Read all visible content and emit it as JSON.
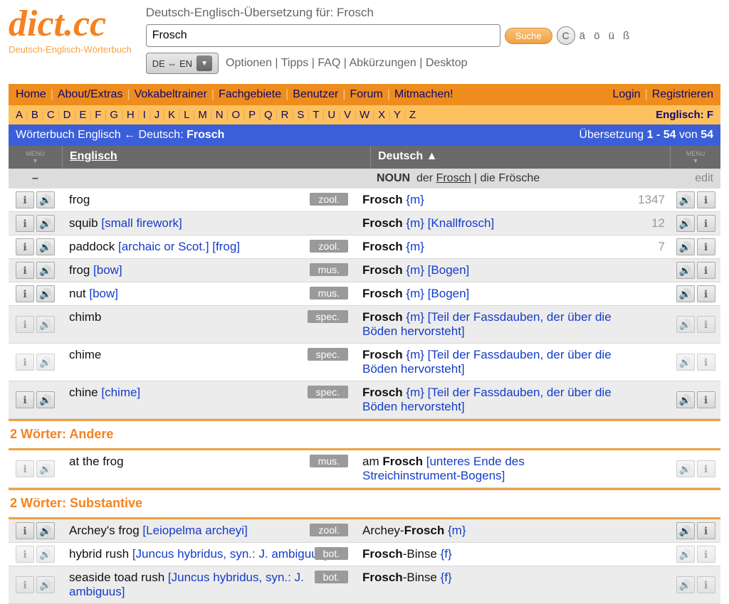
{
  "logo": "dict.cc",
  "logo_sub": "Deutsch-Englisch-Wörterbuch",
  "search_title": "Deutsch-Englisch-Übersetzung für: Frosch",
  "search_value": "Frosch",
  "btn_search": "Suche",
  "btn_c": "C",
  "umlauts": "ä ö ü ß",
  "lang_sel": "DE ⇔ EN",
  "opts": [
    "Optionen",
    "Tipps",
    "FAQ",
    "Abkürzungen",
    "Desktop"
  ],
  "nav": [
    "Home",
    "About/Extras",
    "Vokabeltrainer",
    "Fachgebiete",
    "Benutzer",
    "Forum",
    "Mitmachen!"
  ],
  "nav_right": [
    "Login",
    "Registrieren"
  ],
  "alpha": [
    "A",
    "B",
    "C",
    "D",
    "E",
    "F",
    "G",
    "H",
    "I",
    "J",
    "K",
    "L",
    "M",
    "N",
    "O",
    "P",
    "Q",
    "R",
    "S",
    "T",
    "U",
    "V",
    "W",
    "X",
    "Y",
    "Z"
  ],
  "alpha_right": "Englisch: F",
  "blue_left_a": "Wörterbuch Englisch ← Deutsch: ",
  "blue_left_b": "Frosch",
  "blue_right_a": "Übersetzung ",
  "blue_right_b": "1 - 54",
  "blue_right_c": " von ",
  "blue_right_d": "54",
  "col_en": "Englisch",
  "col_de": "Deutsch",
  "col_de_sort": "▲",
  "menu_label": "MENU",
  "noun_dash": "–",
  "noun_label": "NOUN",
  "noun_text_a": "der ",
  "noun_text_b": "Frosch",
  "noun_text_c": " | die Frösche",
  "edit": "edit",
  "rows": [
    {
      "en": "frog",
      "en_ext": "",
      "tag": "zool.",
      "de": "Frosch",
      "g": "{m}",
      "de_ext": "",
      "cnt": "1347",
      "bold": true,
      "g2": false
    },
    {
      "en": "squib",
      "en_ext": " [small firework]",
      "tag": "",
      "de": "Frosch",
      "g": "{m}",
      "de_ext": " [Knallfrosch]",
      "cnt": "12",
      "bold": true,
      "g2": true
    },
    {
      "en": "paddock",
      "en_ext": " [archaic or Scot.] [frog]",
      "tag": "zool.",
      "de": "Frosch",
      "g": "{m}",
      "de_ext": "",
      "cnt": "7",
      "bold": true,
      "g2": false
    },
    {
      "en": "frog",
      "en_ext": " [bow]",
      "tag": "mus.",
      "de": "Frosch",
      "g": "{m}",
      "de_ext": " [Bogen]",
      "cnt": "",
      "bold": true,
      "g2": true
    },
    {
      "en": "nut",
      "en_ext": " [bow]",
      "tag": "mus.",
      "de": "Frosch",
      "g": "{m}",
      "de_ext": " [Bogen]",
      "cnt": "",
      "bold": true,
      "g2": false
    },
    {
      "en": "chimb",
      "en_ext": "",
      "tag": "spec.",
      "de": "Frosch",
      "g": "{m}",
      "de_ext": " [Teil der Fassdauben, der über die Böden hervorsteht]",
      "cnt": "",
      "bold": false,
      "g2": true
    },
    {
      "en": "chime",
      "en_ext": "",
      "tag": "spec.",
      "de": "Frosch",
      "g": "{m}",
      "de_ext": " [Teil der Fassdauben, der über die Böden hervorsteht]",
      "cnt": "",
      "bold": false,
      "g2": false
    },
    {
      "en": "chine",
      "en_ext": " [chime]",
      "tag": "spec.",
      "de": "Frosch",
      "g": "{m}",
      "de_ext": " [Teil der Fassdauben, der über die Böden hervorsteht]",
      "cnt": "",
      "bold": true,
      "g2": true
    }
  ],
  "sec1": "2 Wörter: Andere",
  "rows2": [
    {
      "en": "at the frog",
      "en_ext": "",
      "tag": "mus.",
      "de_pre": "am ",
      "de": "Frosch",
      "de_ext": " [unteres Ende des Streichinstrument-Bogens]",
      "g": "",
      "cnt": "",
      "g2": false
    }
  ],
  "sec2": "2 Wörter: Substantive",
  "rows3": [
    {
      "en": "Archey's frog",
      "en_ext": " [Leiopelma archeyi]",
      "tag": "zool.",
      "de_pre": "Archey-",
      "de": "Frosch",
      "g": "{m}",
      "de_ext": "",
      "g2": true
    },
    {
      "en": "hybrid rush",
      "en_ext": " [Juncus hybridus, syn.: J. ambiguus]",
      "tag": "bot.",
      "de_pre": "",
      "de": "Frosch",
      "de_post": "-Binse",
      "g": "{f}",
      "de_ext": "",
      "g2": false
    },
    {
      "en": "seaside toad rush",
      "en_ext": " [Juncus hybridus, syn.: J. ambiguus]",
      "tag": "bot.",
      "de_pre": "",
      "de": "Frosch",
      "de_post": "-Binse",
      "g": "{f}",
      "de_ext": "",
      "g2": true
    }
  ]
}
